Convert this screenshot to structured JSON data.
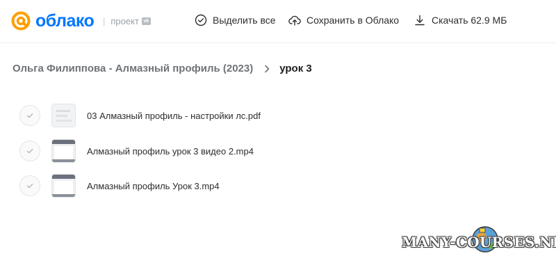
{
  "header": {
    "logo_text": "облако",
    "project_separator": "|",
    "project_label": "проект",
    "project_badge": "vk",
    "brand_color": "#0077ff",
    "actions": {
      "select_all": "Выделить все",
      "save_to_cloud": "Сохранить в Облако",
      "download": "Скачать 62.9 МБ"
    },
    "icons": {
      "select_all": "check-circle-icon",
      "save_to_cloud": "cloud-upload-icon",
      "download": "download-icon"
    }
  },
  "breadcrumb": {
    "parent": "Ольга Филиппова - Алмазный профиль (2023)",
    "current": "урок 3"
  },
  "files": [
    {
      "name": "03 Алмазный профиль - настройки лс.pdf",
      "kind": "pdf"
    },
    {
      "name": "Алмазный профиль урок 3 видео 2.mp4",
      "kind": "video"
    },
    {
      "name": "Алмазный профиль Урок 3.mp4",
      "kind": "video"
    }
  ],
  "watermark": {
    "text": "MANY-COURSES.NET"
  }
}
